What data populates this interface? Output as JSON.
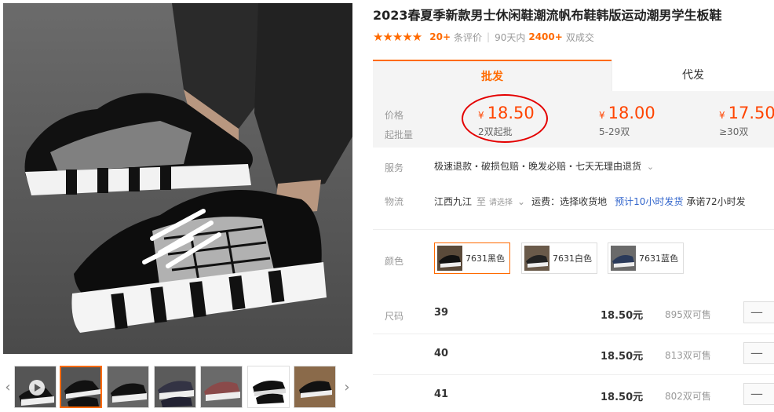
{
  "product": {
    "title": "2023春夏季新款男士休闲鞋潮流帆布鞋韩版运动潮男学生板鞋",
    "stars": "★★★★★",
    "review_count": "20+",
    "review_label": "条评价",
    "period_label": "90天内",
    "sold_count": "2400+",
    "sold_label": "双成交"
  },
  "tabs": [
    {
      "label": "批发"
    },
    {
      "label": "代发"
    }
  ],
  "price_box": {
    "price_label": "价格",
    "moq_label": "起批量",
    "currency": "¥",
    "tiers": [
      {
        "price": "18.50",
        "qty": "2双起批"
      },
      {
        "price": "18.00",
        "qty": "5-29双"
      },
      {
        "price": "17.50",
        "qty": "≥30双"
      }
    ]
  },
  "service": {
    "label": "服务",
    "text": "极速退款・破损包赔・晚发必赔・七天无理由退货"
  },
  "logistics": {
    "label": "物流",
    "origin": "江西九江",
    "to": "至",
    "select_placeholder": "请选择",
    "freight": "运费：选择收货地",
    "delivery": "预计10小时发货",
    "promise": "承诺72小时发"
  },
  "colors": {
    "label": "颜色",
    "options": [
      {
        "name": "7631黑色",
        "selected": true
      },
      {
        "name": "7631白色",
        "selected": false
      },
      {
        "name": "7631蓝色",
        "selected": false
      }
    ]
  },
  "sizes": {
    "label": "尺码",
    "rows": [
      {
        "size": "39",
        "price": "18.50元",
        "stock": "895双可售",
        "stepper": "—"
      },
      {
        "size": "40",
        "price": "18.50元",
        "stock": "813双可售",
        "stepper": "—"
      },
      {
        "size": "41",
        "price": "18.50元",
        "stock": "802双可售",
        "stepper": "—"
      }
    ]
  },
  "gallery": {
    "prev_arrow": "‹",
    "next_arrow": "›"
  },
  "colors_theme": {
    "accent": "#ff6a00",
    "price": "#ff4400",
    "annotation_circle": "#e40000",
    "link": "#3366cc"
  }
}
